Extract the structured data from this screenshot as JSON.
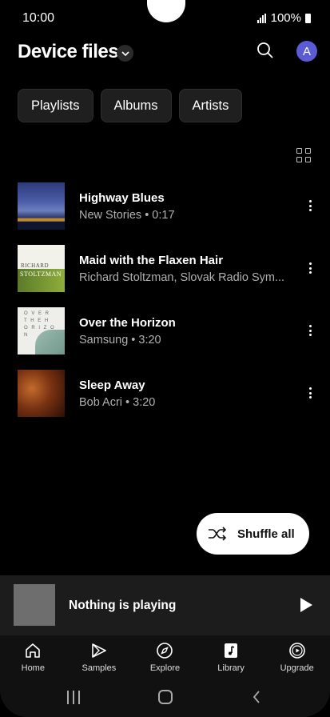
{
  "status": {
    "time": "10:00",
    "battery": "100%"
  },
  "header": {
    "title": "Device files",
    "avatar_letter": "A"
  },
  "chips": [
    "Playlists",
    "Albums",
    "Artists"
  ],
  "songs": [
    {
      "title": "Highway Blues",
      "subtitle": "New Stories • 0:17"
    },
    {
      "title": "Maid with the Flaxen Hair",
      "subtitle": "Richard Stoltzman, Slovak Radio Sym..."
    },
    {
      "title": "Over the Horizon",
      "subtitle": "Samsung • 3:20"
    },
    {
      "title": "Sleep Away",
      "subtitle": "Bob Acri • 3:20"
    }
  ],
  "album_art_text": {
    "art2_line1": "RICHARD",
    "art2_line2": "STOLTZMAN",
    "art3_text": "O V E R  T H E  H O R I Z O N"
  },
  "shuffle": {
    "label": "Shuffle all"
  },
  "now_playing": {
    "title": "Nothing is playing"
  },
  "nav": [
    {
      "label": "Home",
      "icon": "home-icon"
    },
    {
      "label": "Samples",
      "icon": "samples-icon"
    },
    {
      "label": "Explore",
      "icon": "compass-icon"
    },
    {
      "label": "Library",
      "icon": "library-icon"
    },
    {
      "label": "Upgrade",
      "icon": "upgrade-icon"
    }
  ],
  "colors": {
    "avatar": "#5b5bd6",
    "background": "#000000",
    "accent": "#ffffff"
  }
}
